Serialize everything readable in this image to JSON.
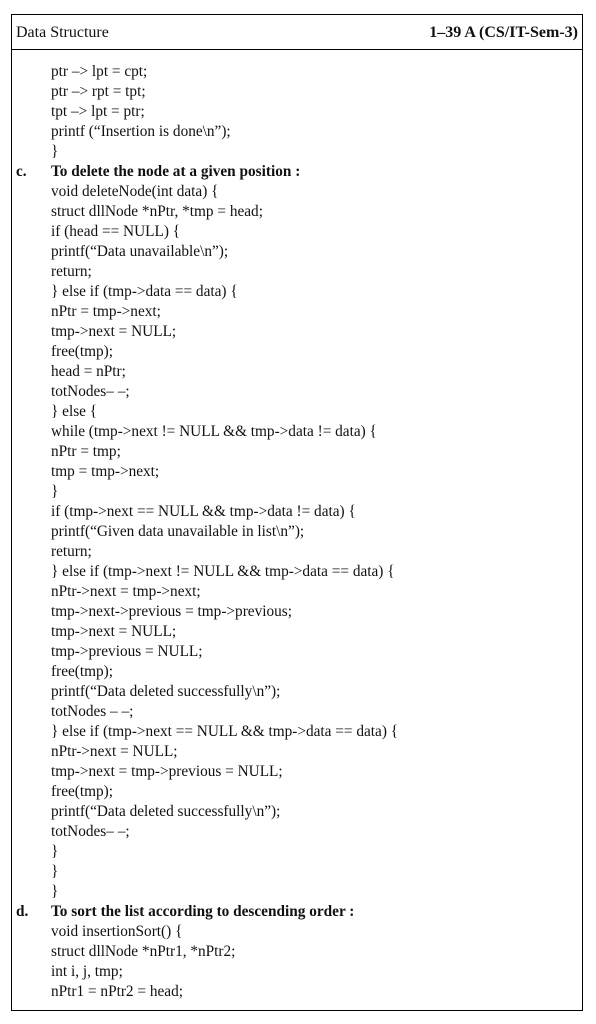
{
  "header": {
    "left": "Data Structure",
    "right": "1–39 A (CS/IT-Sem-3)"
  },
  "lines": [
    {
      "text": "ptr –> lpt = cpt;"
    },
    {
      "text": "ptr –> rpt = tpt;"
    },
    {
      "text": "tpt –> lpt = ptr;"
    },
    {
      "text": "printf (“Insertion is done\\n”);"
    },
    {
      "text": "}"
    },
    {
      "marker": "c.",
      "text": "To delete the node at a given position :",
      "heading": true
    },
    {
      "text": "void deleteNode(int data) {"
    },
    {
      "text": "struct dllNode *nPtr, *tmp = head;"
    },
    {
      "text": "if (head == NULL) {"
    },
    {
      "text": "printf(“Data unavailable\\n”);"
    },
    {
      "text": "return;"
    },
    {
      "text": "} else if (tmp->data == data) {"
    },
    {
      "text": "nPtr = tmp->next;"
    },
    {
      "text": "tmp->next = NULL;"
    },
    {
      "text": "free(tmp);"
    },
    {
      "text": "head = nPtr;"
    },
    {
      "text": "totNodes– –;"
    },
    {
      "text": "} else {"
    },
    {
      "text": "while (tmp->next != NULL && tmp->data != data) {"
    },
    {
      "text": "nPtr = tmp;"
    },
    {
      "text": "tmp = tmp->next;"
    },
    {
      "text": "}"
    },
    {
      "text": "if (tmp->next == NULL && tmp->data != data) {"
    },
    {
      "text": "printf(“Given data unavailable in list\\n”);"
    },
    {
      "text": "return;"
    },
    {
      "text": "} else if (tmp->next != NULL && tmp->data == data) {"
    },
    {
      "text": "nPtr->next = tmp->next;"
    },
    {
      "text": "tmp->next->previous = tmp->previous;"
    },
    {
      "text": "tmp->next = NULL;"
    },
    {
      "text": "tmp->previous = NULL;"
    },
    {
      "text": "free(tmp);"
    },
    {
      "text": "printf(“Data deleted successfully\\n”);"
    },
    {
      "text": "totNodes – –;"
    },
    {
      "text": "} else if (tmp->next == NULL && tmp->data == data) {"
    },
    {
      "text": "nPtr->next = NULL;"
    },
    {
      "text": "tmp->next = tmp->previous = NULL;"
    },
    {
      "text": "free(tmp);"
    },
    {
      "text": "printf(“Data deleted successfully\\n”);"
    },
    {
      "text": "totNodes– –;"
    },
    {
      "text": "}"
    },
    {
      "text": "}"
    },
    {
      "text": "}"
    },
    {
      "marker": "d.",
      "text": "To sort the list according to descending order :",
      "heading": true
    },
    {
      "text": "void insertionSort() {"
    },
    {
      "text": "struct dllNode *nPtr1, *nPtr2;"
    },
    {
      "text": "int i, j, tmp;"
    },
    {
      "text": "nPtr1 = nPtr2 = head;"
    }
  ]
}
